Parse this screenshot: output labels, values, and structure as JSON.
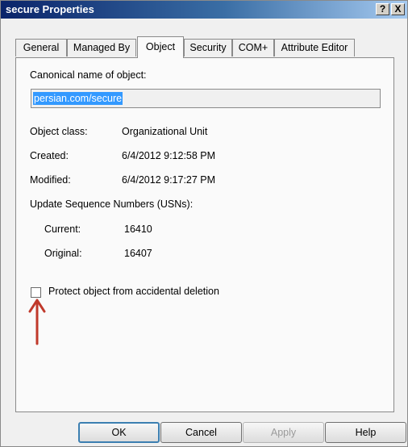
{
  "window": {
    "title": "secure Properties",
    "help_glyph": "?",
    "close_glyph": "X"
  },
  "tabs": [
    {
      "label": "General",
      "active": false
    },
    {
      "label": "Managed By",
      "active": false
    },
    {
      "label": "Object",
      "active": true
    },
    {
      "label": "Security",
      "active": false
    },
    {
      "label": "COM+",
      "active": false
    },
    {
      "label": "Attribute Editor",
      "active": false
    }
  ],
  "object": {
    "canonical_label": "Canonical name of object:",
    "canonical_value": "persian.com/secure",
    "class_label": "Object class:",
    "class_value": "Organizational Unit",
    "created_label": "Created:",
    "created_value": "6/4/2012 9:12:58 PM",
    "modified_label": "Modified:",
    "modified_value": "6/4/2012 9:17:27 PM",
    "usn_heading": "Update Sequence Numbers (USNs):",
    "current_label": "Current:",
    "current_value": "16410",
    "original_label": "Original:",
    "original_value": "16407",
    "protect_label": "Protect object from accidental deletion",
    "protect_checked": false
  },
  "annotation": {
    "arrow_color": "#c0392b"
  },
  "buttons": {
    "ok": "OK",
    "cancel": "Cancel",
    "apply": "Apply",
    "help": "Help"
  }
}
